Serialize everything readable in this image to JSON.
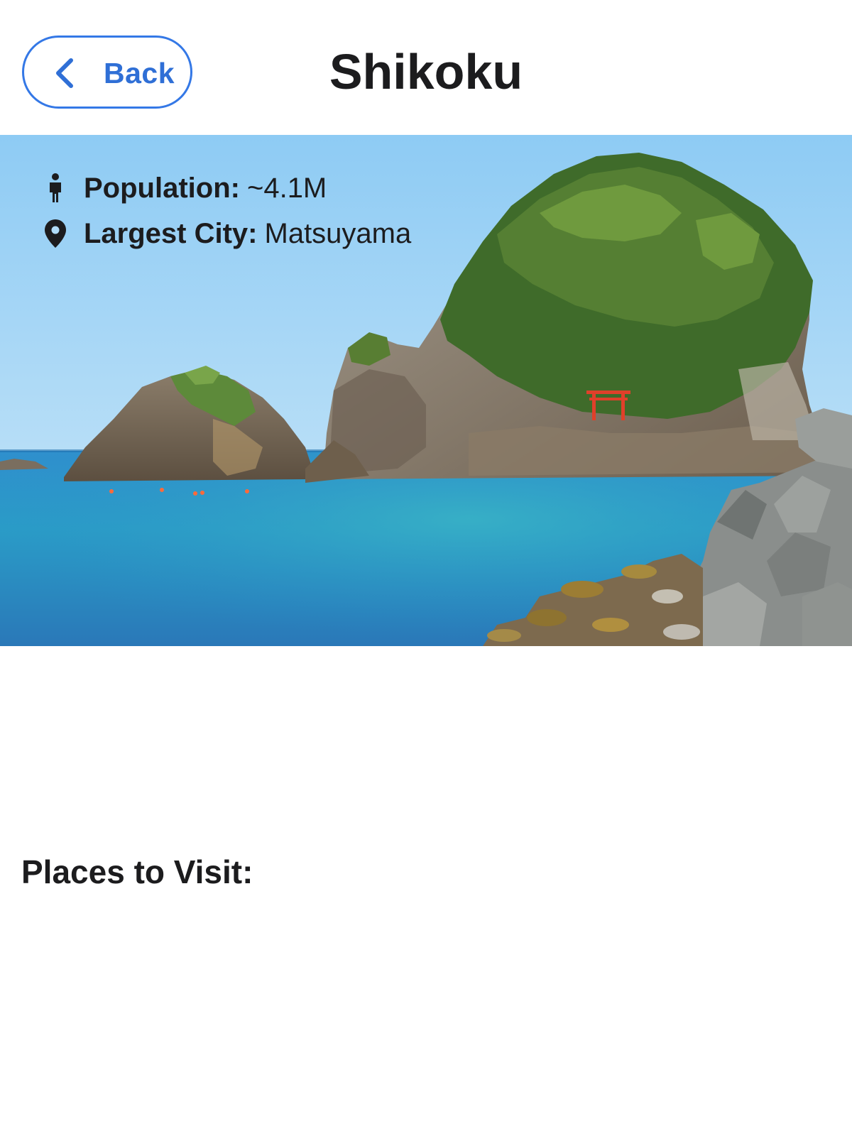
{
  "header": {
    "back_label": "Back",
    "title": "Shikoku"
  },
  "hero": {
    "image_alt": "Coastal rock islands with a red torii gate",
    "population": {
      "label": "Population:",
      "value": "~4.1M",
      "icon": "person-icon"
    },
    "largest_city": {
      "label": "Largest City:",
      "value": "Matsuyama",
      "icon": "map-pin-icon"
    }
  },
  "places": {
    "title": "Places to Visit:"
  },
  "colors": {
    "accent": "#3478e6",
    "text": "#1c1c1e",
    "sky": "#9fd2f5",
    "sea": "#2b8fc9",
    "torii": "#e0402a"
  }
}
